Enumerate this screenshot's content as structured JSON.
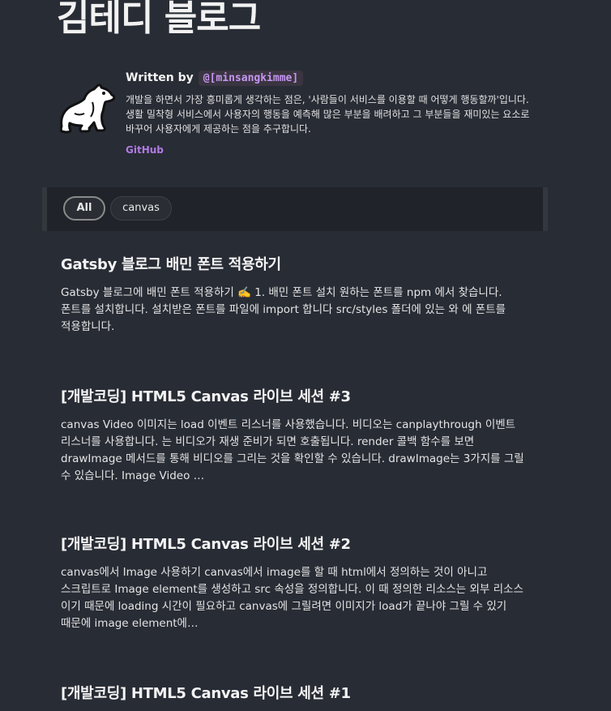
{
  "blog": {
    "title": "김테디 블로그"
  },
  "bio": {
    "written_by": "Written by",
    "handle": "@[minsangkimme]",
    "description": "개발을 하면서 가장 흥미롭게 생각하는 점은, '사람들이 서비스를 이용할 때 어떻게 행동할까'입니다. 생활 밀착형 서비스에서 사용자의 행동을 예측해 많은 부분을 배려하고 그 부분들을 재미있는 요소로 바꾸어 사용자에게 제공하는 점을 추구합니다.",
    "github_label": "GitHub",
    "avatar_icon": "polar-bear-icon"
  },
  "tags": [
    {
      "label": "All",
      "active": true
    },
    {
      "label": "canvas",
      "active": false
    }
  ],
  "posts": [
    {
      "title": "Gatsby 블로그 배민 폰트 적용하기",
      "excerpt": "Gatsby 블로그에 배민 폰트 적용하기 ✍️ 1. 배민 폰트 설치 원하는 폰트를 npm 에서 찾습니다. 폰트를 설치합니다. 설치받은 폰트를 파일에 import 합니다 src/styles 폴더에 있는 와 에 폰트를 적용합니다."
    },
    {
      "title": "[개발코딩] HTML5 Canvas 라이브 세션 #3",
      "excerpt": "canvas Video 이미지는 load 이벤트 리스너를 사용했습니다. 비디오는 canplaythrough 이벤트 리스너를 사용합니다. 는 비디오가 재생 준비가 되면 호출됩니다. render 콜백 함수를 보면 drawImage 메서드를 통해 비디오를 그리는 것을 확인할 수 있습니다. drawImage는 3가지를 그릴 수 있습니다. Image Video …"
    },
    {
      "title": "[개발코딩] HTML5 Canvas 라이브 세션 #2",
      "excerpt": "canvas에서 Image 사용하기 canvas에서 image를 할 때 html에서 정의하는 것이 아니고 스크립트로 Image element를 생성하고 src 속성을 정의합니다. 이 때 정의한 리소스는 외부 리소스 이기 때문에 loading 시간이 필요하고 canvas에 그릴려면 이미지가 load가 끝나야 그릴 수 있기 때문에 image element에…"
    },
    {
      "title": "[개발코딩] HTML5 Canvas 라이브 세션 #1",
      "excerpt": ""
    }
  ],
  "colors": {
    "background": "#282c35",
    "accent": "#c696f2",
    "link": "#b07be3",
    "tag_bar": "#202329"
  }
}
